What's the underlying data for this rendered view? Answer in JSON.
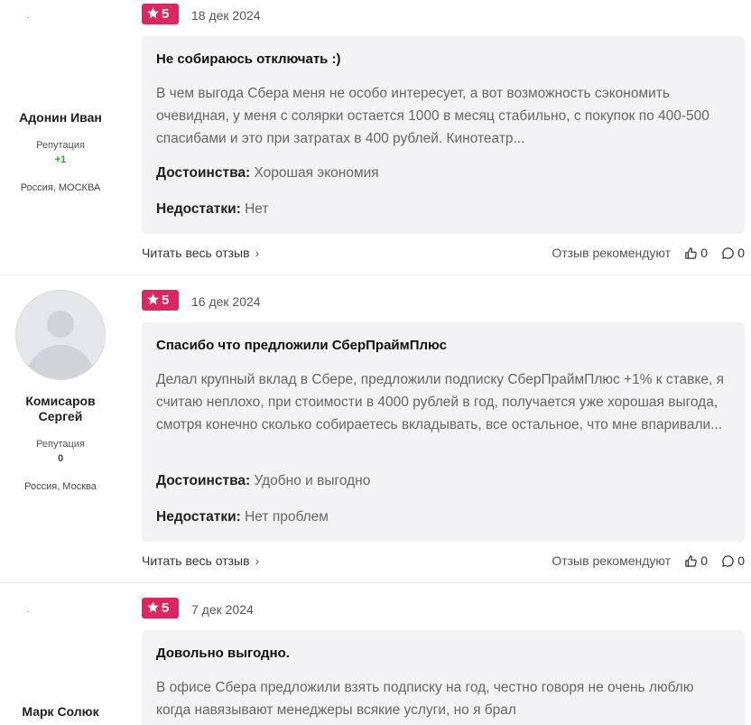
{
  "reviews": [
    {
      "author": {
        "name": "Адонин Иван",
        "reputation_label": "Репутация",
        "reputation": "+1",
        "location": "Россия, МОСКВА",
        "avatar": "broken-image",
        "avatar_placeholder": "."
      },
      "rating": "5",
      "date": "18 дек 2024",
      "title": "Не собираюсь отключать :)",
      "text": "В чем выгода Сбера меня не особо интересует, а вот возможность сэкономить очевидная, у меня с солярки остается 1000 в месяц стабильно, с покупок по 400-500 спасибами и это при затратах в 400 рублей. Кинотеатр...",
      "pros_label": "Достоинства:",
      "pros": "Хорошая экономия",
      "cons_label": "Недостатки:",
      "cons": "Нет",
      "read_more": "Читать весь отзыв",
      "recommend_label": "Отзыв рекомендуют",
      "likes": "0",
      "comments": "0"
    },
    {
      "author": {
        "name": "Комисаров Сергей",
        "reputation_label": "Репутация",
        "reputation": "0",
        "location": "Россия, Москва",
        "avatar": "default-user-avatar"
      },
      "rating": "5",
      "date": "16 дек 2024",
      "title": "Спасибо что предложили СберПраймПлюс",
      "text": "Делал крупный вклад в Сбере, предложили подписку СберПраймПлюс +1% к ставке, я считаю неплохо, при стоимости в 4000 рублей в год, получается уже хорошая выгода, смотря конечно сколько собираетесь вкладывать, все остальное, что мне впаривали...",
      "pros_label": "Достоинства:",
      "pros": "Удобно и выгодно",
      "cons_label": "Недостатки:",
      "cons": "Нет проблем",
      "read_more": "Читать весь отзыв",
      "recommend_label": "Отзыв рекомендуют",
      "likes": "0",
      "comments": "0"
    },
    {
      "author": {
        "name": "Марк Солюк",
        "avatar": "broken-image",
        "avatar_placeholder": "."
      },
      "rating": "5",
      "date": "7 дек 2024",
      "title": "Довольно выгодно.",
      "text": "В офисе Сбера предложили взять подписку на год, честно говоря не очень люблю когда навязывают менеджеры всякие услуги, но я брал"
    }
  ],
  "colors": {
    "badge": "#e0245e",
    "card_bg": "#f3f3f5",
    "reputation_positive": "#2e9b2e"
  },
  "icons": {
    "rating": "star-icon",
    "read_more": "chevron-right-icon",
    "likes": "thumbs-up-icon",
    "comments": "comment-icon"
  }
}
